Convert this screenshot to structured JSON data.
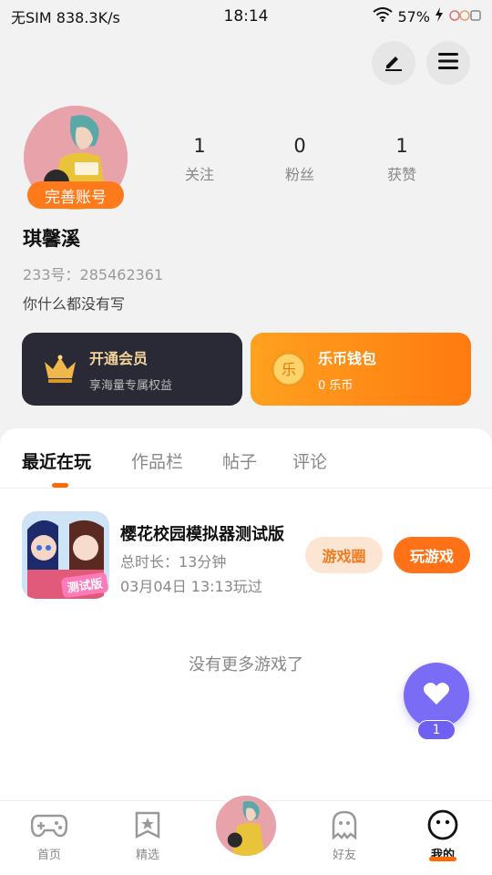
{
  "status_bar": {
    "carrier": "无SIM",
    "speed": "838.3K/s",
    "time": "18:14",
    "battery": "57%"
  },
  "header": {
    "edit_icon": "pen-icon",
    "menu_icon": "menu-icon"
  },
  "profile": {
    "badge": "完善账号",
    "stats": [
      {
        "value": "1",
        "label": "关注"
      },
      {
        "value": "0",
        "label": "粉丝"
      },
      {
        "value": "1",
        "label": "获赞"
      }
    ],
    "name": "琪馨溪",
    "uid": "233号：285462361",
    "bio": "你什么都没有写"
  },
  "cards": {
    "vip": {
      "title": "开通会员",
      "subtitle": "享海量专属权益"
    },
    "wallet": {
      "title": "乐币钱包",
      "subtitle": "0 乐币",
      "coin_glyph": "乐"
    }
  },
  "tabs": [
    "最近在玩",
    "作品栏",
    "帖子",
    "评论"
  ],
  "game": {
    "title": "樱花校园模拟器测试版",
    "duration": "总时长：13分钟",
    "last_played": "03月04日 13:13玩过",
    "icon_label": "测试版",
    "circle_button": "游戏圈",
    "play_button": "玩游戏"
  },
  "empty_text": "没有更多游戏了",
  "fab": {
    "count": "1"
  },
  "nav": [
    {
      "label": "首页",
      "icon": "gamepad-icon"
    },
    {
      "label": "精选",
      "icon": "star-icon"
    },
    {
      "label": "好友",
      "icon": "ghost-icon"
    },
    {
      "label": "我的",
      "icon": "smiley-icon"
    }
  ],
  "colors": {
    "accent": "#ff7117",
    "purple": "#7b6cf6",
    "vip_bg": "#2a2a36"
  }
}
